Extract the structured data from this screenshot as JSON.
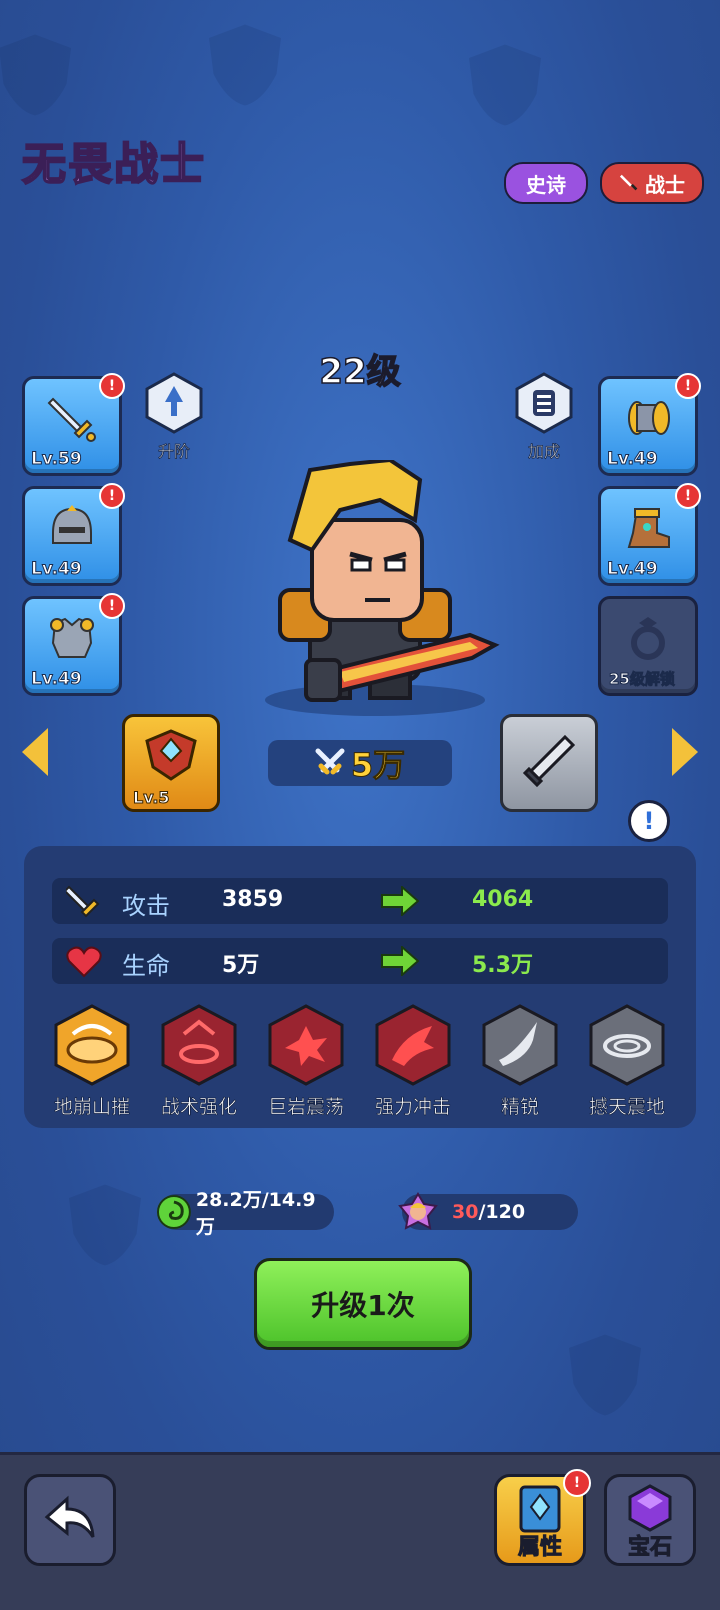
{
  "hero": {
    "name": "无畏战士",
    "rarity_badge": "史诗",
    "class_badge": "战士",
    "level_text": "22级",
    "power": "5万"
  },
  "equipment_left": [
    {
      "icon": "sword-icon",
      "level": "Lv.59",
      "alert": "!"
    },
    {
      "icon": "helmet-icon",
      "level": "Lv.49",
      "alert": "!"
    },
    {
      "icon": "armor-icon",
      "level": "Lv.49",
      "alert": "!"
    }
  ],
  "equipment_right": [
    {
      "icon": "bracer-icon",
      "level": "Lv.49",
      "alert": "!"
    },
    {
      "icon": "boots-icon",
      "level": "Lv.49",
      "alert": "!"
    },
    {
      "icon": "ring-lock-icon",
      "level": "25级解锁"
    }
  ],
  "actions": {
    "ascend_label": "升阶",
    "bonus_label": "加成"
  },
  "items": {
    "emblem_level": "Lv.5",
    "info_mark": "!"
  },
  "stats": [
    {
      "name": "攻击",
      "current": "3859",
      "next": "4064",
      "icon": "sword-icon"
    },
    {
      "name": "生命",
      "current": "5万",
      "next": "5.3万",
      "icon": "heart-icon"
    }
  ],
  "skills": [
    {
      "name": "地崩山摧",
      "active": true
    },
    {
      "name": "战术强化",
      "active": false
    },
    {
      "name": "巨岩震荡",
      "active": false
    },
    {
      "name": "强力冲击",
      "active": false
    },
    {
      "name": "精锐",
      "active": false
    },
    {
      "name": "撼天震地",
      "active": false
    }
  ],
  "resources": {
    "exp_text": "28.2万/14.9万",
    "shard_current": "30",
    "shard_total": "/120"
  },
  "upgrade_button": "升级1次",
  "bottom_bar": {
    "attributes_label": "属性",
    "gems_label": "宝石",
    "attributes_alert": "!"
  },
  "colors": {
    "accent_green": "#8bea4d",
    "title_purple": "#d9a6ff",
    "epic_purple": "#9a52e0",
    "warrior_red": "#d6433f",
    "gold": "#ffd23a"
  }
}
